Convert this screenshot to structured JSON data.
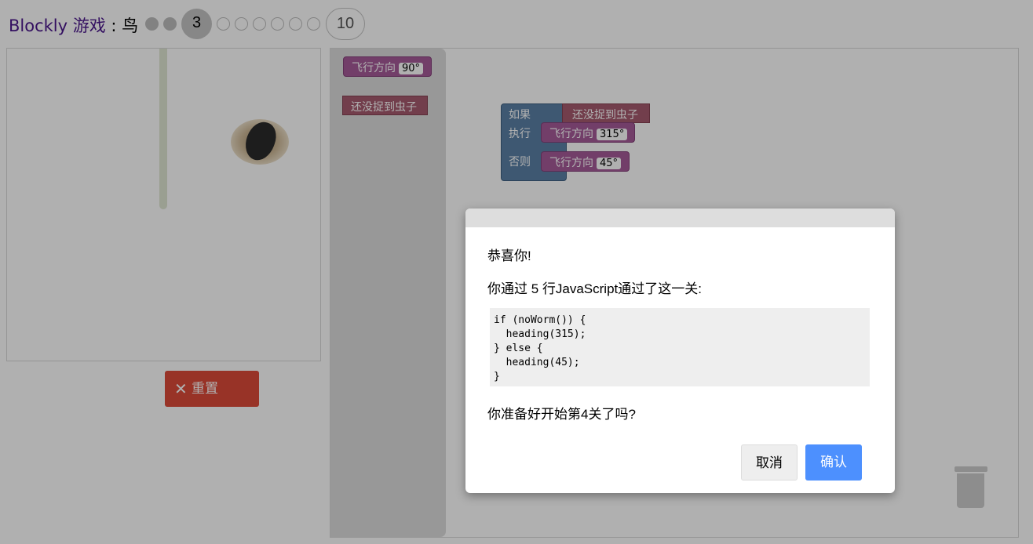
{
  "header": {
    "app_link": "Blockly 游戏",
    "separator": " : ",
    "game_name": "鸟",
    "current_level": "3",
    "last_level": "10"
  },
  "levels": {
    "completed": [
      1,
      2
    ],
    "current": 3,
    "total": 10
  },
  "game": {
    "reset_label": "重置",
    "reset_icon": "close-x-icon"
  },
  "toolbox": {
    "heading_block": {
      "label": "飞行方向",
      "value": "90°"
    },
    "noworm_block": {
      "label": "还没捉到虫子"
    }
  },
  "program": {
    "if_label": "如果",
    "do_label": "执行",
    "else_label": "否则",
    "condition": "还没捉到虫子",
    "do_block": {
      "label": "飞行方向",
      "value": "315°"
    },
    "else_block": {
      "label": "飞行方向",
      "value": "45°"
    }
  },
  "dialog": {
    "congrats": "恭喜你!",
    "summary": "你通过 5 行JavaScript通过了这一关:",
    "code_lines": [
      "if (noWorm()) {",
      "  heading(315);",
      "} else {",
      "  heading(45);",
      "}"
    ],
    "question": "你准备好开始第4关了吗?",
    "cancel_label": "取消",
    "ok_label": "确认"
  },
  "colors": {
    "title_link": "#4a168c",
    "reset_button": "#dd4b39",
    "heading_block": "#a55b99",
    "condition_block": "#a55b6f",
    "if_block": "#5b80a5",
    "ok_button": "#4d90fe"
  }
}
